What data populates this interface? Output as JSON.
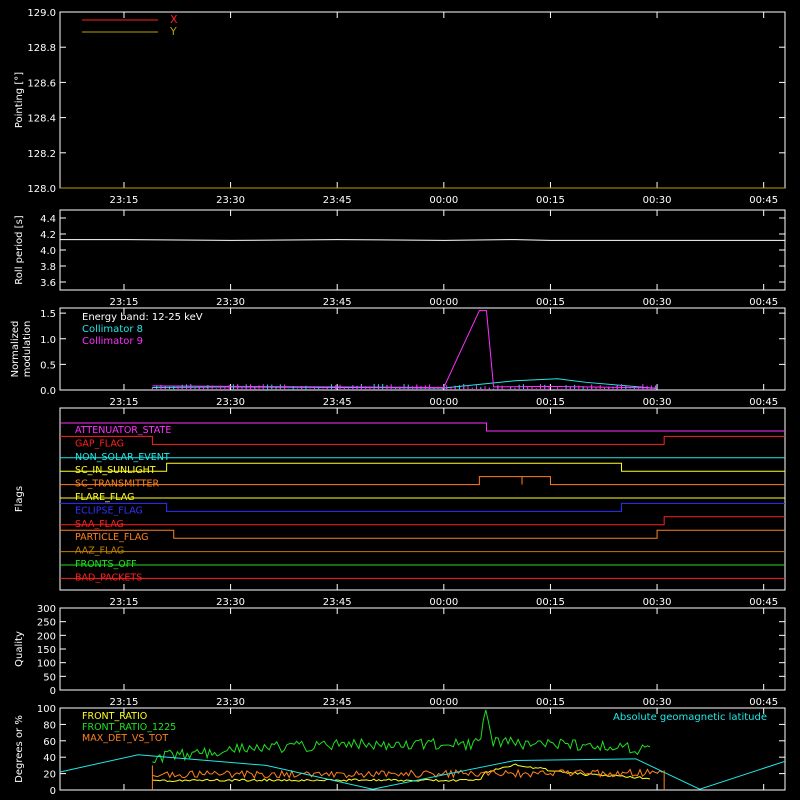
{
  "time_ticks": [
    "23:15",
    "23:30",
    "23:45",
    "00:00",
    "00:15",
    "00:30",
    "00:45"
  ],
  "colors": {
    "white": "#ffffff",
    "red": "#ff2020",
    "olive": "#b4a000",
    "cyan": "#20e8e8",
    "magenta": "#ff30ff",
    "orange": "#ff8020",
    "yellow": "#ffff20",
    "blue": "#3030ff",
    "green": "#20e020",
    "amber": "#c08000"
  },
  "chart_data": [
    {
      "type": "line",
      "ylabel": "Pointing [°]",
      "ylim": [
        128.0,
        129.0
      ],
      "yticks": [
        "128.0",
        "128.2",
        "128.4",
        "128.6",
        "128.8",
        "129.0"
      ],
      "legend": [
        "X",
        "Y"
      ],
      "series": [
        {
          "name": "X",
          "color": "red",
          "x": [],
          "y": []
        },
        {
          "name": "Y",
          "color": "olive",
          "x": [
            "23:06",
            "00:48"
          ],
          "y": [
            128.0,
            128.0
          ]
        }
      ]
    },
    {
      "type": "line",
      "ylabel": "Roll period [s]",
      "ylim": [
        3.5,
        4.5
      ],
      "yticks": [
        "3.6",
        "3.8",
        "4.0",
        "4.2",
        "4.4"
      ],
      "series": [
        {
          "color": "white",
          "x": [
            "23:06",
            "23:15",
            "23:30",
            "23:45",
            "00:00",
            "00:10",
            "00:15",
            "00:30",
            "00:45",
            "00:48"
          ],
          "y": [
            4.13,
            4.13,
            4.12,
            4.13,
            4.12,
            4.13,
            4.12,
            4.12,
            4.12,
            4.12
          ]
        }
      ]
    },
    {
      "type": "line",
      "ylabel": "Normalized modulation",
      "ylim": [
        0,
        1.6
      ],
      "yticks": [
        "0.0",
        "0.5",
        "1.0",
        "1.5"
      ],
      "annotation": "Energy band: 12-25 keV",
      "legend": [
        "Collimator 8",
        "Collimator 9"
      ],
      "series": [
        {
          "name": "Collimator 8",
          "color": "cyan",
          "x": [
            "23:19",
            "23:30",
            "23:45",
            "00:00",
            "00:10",
            "00:16",
            "00:20",
            "00:30"
          ],
          "y": [
            0.05,
            0.06,
            0.05,
            0.04,
            0.18,
            0.22,
            0.15,
            0.03
          ]
        },
        {
          "name": "Collimator 9",
          "color": "magenta",
          "x": [
            "23:19",
            "23:30",
            "23:45",
            "00:00",
            "00:05",
            "00:06",
            "00:07",
            "00:15",
            "00:30"
          ],
          "y": [
            0.08,
            0.07,
            0.06,
            0.05,
            1.55,
            1.55,
            0.06,
            0.07,
            0.04
          ]
        }
      ]
    },
    {
      "type": "step",
      "ylabel": "Flags",
      "flags": [
        {
          "name": "ATTENUATOR_STATE",
          "color": "magenta",
          "steps": [
            [
              "23:06",
              1
            ],
            [
              "00:06",
              0
            ]
          ]
        },
        {
          "name": "GAP_FLAG",
          "color": "red",
          "steps": [
            [
              "23:06",
              1
            ],
            [
              "23:19",
              0
            ],
            [
              "00:31",
              1
            ]
          ]
        },
        {
          "name": "NON_SOLAR_EVENT",
          "color": "cyan",
          "steps": [
            [
              "23:06",
              0
            ]
          ]
        },
        {
          "name": "SC_IN_SUNLIGHT",
          "color": "yellow",
          "steps": [
            [
              "23:06",
              0
            ],
            [
              "23:21",
              1
            ],
            [
              "00:25",
              0
            ]
          ]
        },
        {
          "name": "SC_TRANSMITTER",
          "color": "orange",
          "steps": [
            [
              "23:06",
              0
            ],
            [
              "00:05",
              1
            ],
            [
              "00:11",
              0
            ],
            [
              "00:11",
              1
            ],
            [
              "00:15",
              0
            ]
          ]
        },
        {
          "name": "FLARE_FLAG",
          "color": "yellow",
          "steps": [
            [
              "23:06",
              0
            ]
          ]
        },
        {
          "name": "ECLIPSE_FLAG",
          "color": "blue",
          "steps": [
            [
              "23:06",
              1
            ],
            [
              "23:21",
              0
            ],
            [
              "00:25",
              1
            ]
          ]
        },
        {
          "name": "SAA_FLAG",
          "color": "red",
          "steps": [
            [
              "23:06",
              0
            ],
            [
              "00:31",
              1
            ]
          ]
        },
        {
          "name": "PARTICLE_FLAG",
          "color": "orange",
          "steps": [
            [
              "23:06",
              1
            ],
            [
              "23:22",
              0
            ],
            [
              "00:30",
              1
            ]
          ]
        },
        {
          "name": "AAZ_FLAG",
          "color": "amber",
          "steps": [
            [
              "23:06",
              0
            ]
          ]
        },
        {
          "name": "FRONTS_OFF",
          "color": "green",
          "steps": [
            [
              "23:06",
              0
            ]
          ]
        },
        {
          "name": "BAD_PACKETS",
          "color": "red",
          "steps": [
            [
              "23:06",
              0
            ]
          ]
        }
      ]
    },
    {
      "type": "line",
      "ylabel": "Quality",
      "ylim": [
        0,
        300
      ],
      "yticks": [
        "0",
        "50",
        "100",
        "150",
        "200",
        "250",
        "300"
      ],
      "series": []
    },
    {
      "type": "line",
      "ylabel": "Degrees or %",
      "ylim": [
        0,
        100
      ],
      "yticks": [
        "0",
        "20",
        "40",
        "60",
        "80",
        "100"
      ],
      "legend": [
        "FRONT_RATIO",
        "FRONT_RATIO_1225",
        "MAX_DET_VS_TOT"
      ],
      "annotation": "Absolute geomagnetic latitude",
      "series": [
        {
          "name": "FRONT_RATIO",
          "color": "yellow",
          "x": [
            "23:19",
            "23:30",
            "23:45",
            "00:00",
            "00:05",
            "00:06",
            "00:10",
            "00:15",
            "00:20",
            "00:29"
          ],
          "y": [
            11,
            12,
            12,
            12,
            12,
            22,
            31,
            24,
            19,
            14
          ]
        },
        {
          "name": "FRONT_RATIO_1225",
          "color": "green",
          "x": [
            "23:19",
            "23:25",
            "23:35",
            "23:45",
            "23:55",
            "00:05",
            "00:06",
            "00:07",
            "00:15",
            "00:25",
            "00:29"
          ],
          "y": [
            40,
            45,
            52,
            55,
            56,
            56,
            100,
            58,
            56,
            52,
            47
          ]
        },
        {
          "name": "MAX_DET_VS_TOT",
          "color": "orange",
          "x": [
            "23:19",
            "23:30",
            "23:45",
            "00:00",
            "00:15",
            "00:30",
            "00:31"
          ],
          "y": [
            20,
            19,
            19,
            20,
            20,
            21,
            23
          ]
        },
        {
          "name": "Absolute geomagnetic latitude",
          "color": "cyan",
          "x": [
            "23:06",
            "23:17",
            "23:35",
            "23:50",
            "00:10",
            "00:27",
            "00:36",
            "00:48"
          ],
          "y": [
            22,
            43,
            30,
            1,
            36,
            38,
            1,
            35
          ]
        }
      ]
    }
  ]
}
